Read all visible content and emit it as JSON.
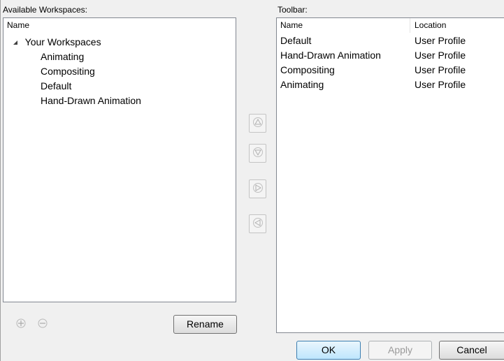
{
  "left": {
    "label": "Available Workspaces:",
    "column_header": "Name",
    "tree_root": "Your Workspaces",
    "tree_children": [
      "Animating",
      "Compositing",
      "Default",
      "Hand-Drawn Animation"
    ],
    "rename_label": "Rename"
  },
  "right": {
    "label": "Toolbar:",
    "columns": [
      "Name",
      "Location"
    ],
    "rows": [
      {
        "name": "Default",
        "location": "User Profile"
      },
      {
        "name": "Hand-Drawn Animation",
        "location": "User Profile"
      },
      {
        "name": "Compositing",
        "location": "User Profile"
      },
      {
        "name": "Animating",
        "location": "User Profile"
      }
    ]
  },
  "icons": {
    "expand": "triangle-down-icon",
    "move_up": "arrow-up-icon",
    "move_down": "arrow-down-icon",
    "add": "arrow-right-icon",
    "remove": "arrow-left-icon",
    "new_workspace": "add-workspace-icon",
    "delete_workspace": "delete-workspace-icon"
  },
  "footer": {
    "ok_label": "OK",
    "apply_label": "Apply",
    "cancel_label": "Cancel"
  },
  "colors": {
    "window_bg": "#f0f0f0",
    "panel_bg": "#ffffff",
    "panel_border": "#828790",
    "default_button_border": "#3c7fb1"
  }
}
